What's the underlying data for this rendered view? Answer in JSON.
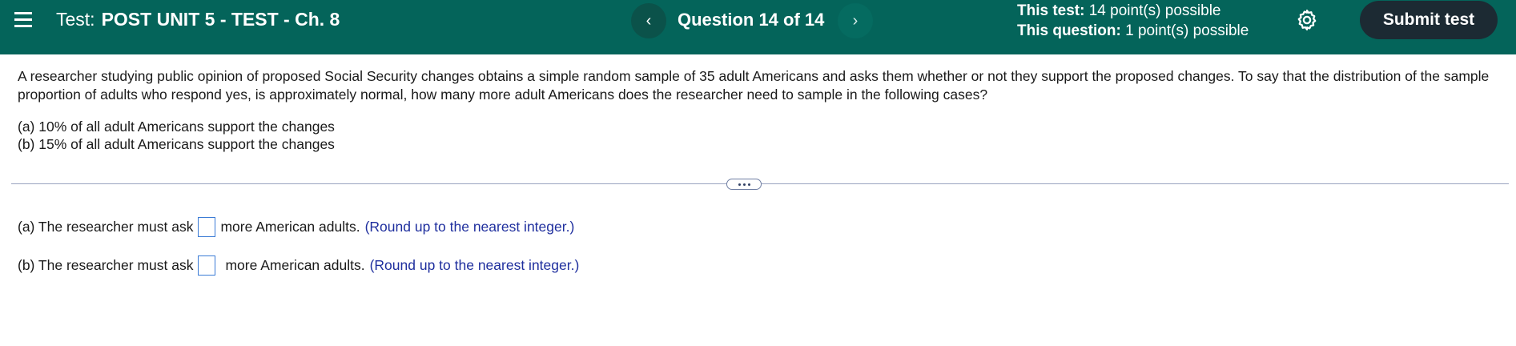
{
  "header": {
    "test_prefix": "Test:",
    "test_name": "POST UNIT 5 - TEST - Ch. 8",
    "question_counter": "Question 14 of 14",
    "prev_symbol": "‹",
    "next_symbol": "›",
    "points_test_label": "This test:",
    "points_test_value": "14 point(s) possible",
    "points_question_label": "This question:",
    "points_question_value": "1 point(s) possible",
    "submit_label": "Submit test",
    "colors": {
      "bar": "#04645a",
      "submit": "#1c2a33"
    }
  },
  "question": {
    "text": "A researcher studying public opinion of proposed Social Security changes obtains a simple random sample of 35 adult Americans and asks them whether or not they support the proposed changes. To say that the distribution of the sample proportion of adults who respond yes, is approximately normal, how many more adult Americans does the researcher need to sample in the following cases?",
    "case_a": "(a) 10% of all adult Americans support the changes",
    "case_b": "(b) 15% of all adult Americans support the changes"
  },
  "answers": {
    "a_prefix": "(a) The researcher must ask",
    "a_suffix": "more American adults.",
    "a_hint": "(Round up to the nearest integer.)",
    "a_value": "",
    "b_prefix": "(b) The researcher must ask",
    "b_suffix": "more American adults.",
    "b_hint": "(Round up to the nearest integer.)",
    "b_value": ""
  },
  "icons": {
    "menu": "hamburger-icon",
    "settings": "gear-icon",
    "expand": "more-dots-icon"
  }
}
